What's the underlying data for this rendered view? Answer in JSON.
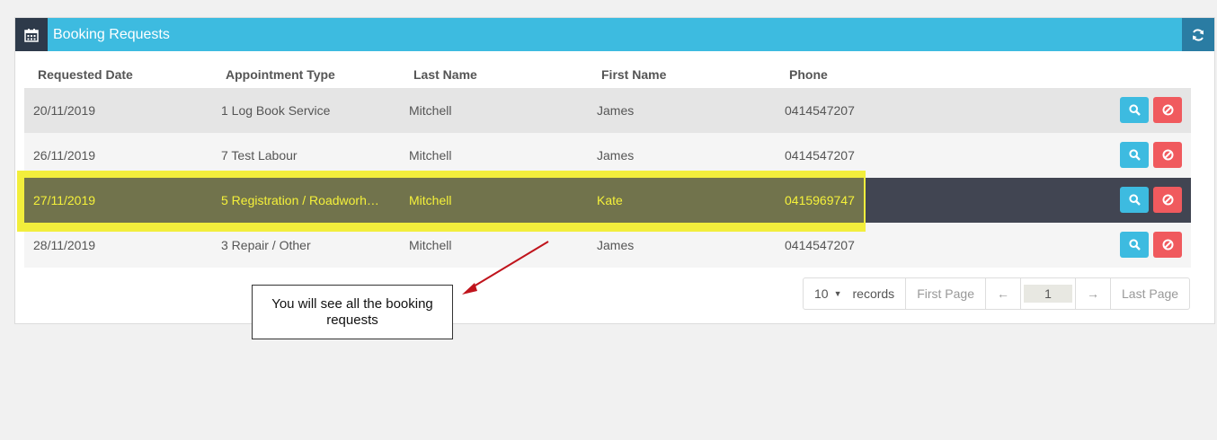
{
  "panel": {
    "title": "Booking Requests",
    "title_icon": "calendar-icon",
    "refresh_icon": "refresh-icon",
    "header_color": "#3dbbe0",
    "header_dark": "#2e3a4a"
  },
  "columns": [
    "Requested Date",
    "Appointment Type",
    "Last Name",
    "First Name",
    "Phone"
  ],
  "rows": [
    {
      "date": "20/11/2019",
      "type": "1 Log Book Service",
      "last": "Mitchell",
      "first": "James",
      "phone": "0414547207"
    },
    {
      "date": "26/11/2019",
      "type": "7 Test Labour",
      "last": "Mitchell",
      "first": "James",
      "phone": "0414547207"
    },
    {
      "date": "27/11/2019",
      "type": "5 Registration / Roadworh…",
      "last": "Mitchell",
      "first": "Kate",
      "phone": "0415969747"
    },
    {
      "date": "28/11/2019",
      "type": "3 Repair / Other",
      "last": "Mitchell",
      "first": "James",
      "phone": "0414547207"
    }
  ],
  "row_actions": {
    "view_icon": "search-icon",
    "cancel_icon": "ban-icon",
    "view_color": "#3dbbe0",
    "cancel_color": "#f05a5e"
  },
  "pagination": {
    "page_size": "10",
    "records_label": "records",
    "first_label": "First Page",
    "prev_label": "←",
    "current_page": "1",
    "next_label": "→",
    "last_label": "Last Page"
  },
  "annotation": {
    "text": "You will see all the booking requests",
    "highlight_color": "#f2ee3c",
    "arrow_color": "#c0141c"
  }
}
